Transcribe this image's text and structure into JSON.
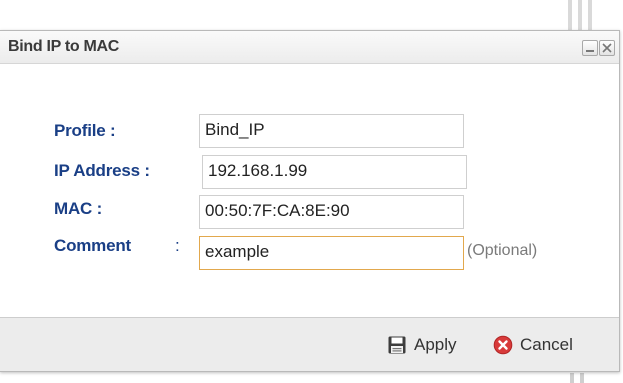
{
  "dialog": {
    "title": "Bind IP to MAC"
  },
  "form": {
    "profile_label": "Profile :",
    "profile_value": "Bind_IP",
    "ip_label": "IP Address :",
    "ip_value": "192.168.1.99",
    "mac_label": "MAC :",
    "mac_value": "00:50:7F:CA:8E:90",
    "comment_label": "Comment",
    "comment_colon": ":",
    "comment_value": "example",
    "optional_hint": "(Optional)"
  },
  "footer": {
    "apply_label": "Apply",
    "cancel_label": "Cancel"
  },
  "icons": {
    "apply": "save-icon",
    "cancel": "cancel-icon",
    "minimize": "minimize-icon",
    "close": "close-icon"
  },
  "colors": {
    "label": "#1a3f86",
    "focus_border": "#e2a84d",
    "cancel_icon": "#d83a3a"
  }
}
